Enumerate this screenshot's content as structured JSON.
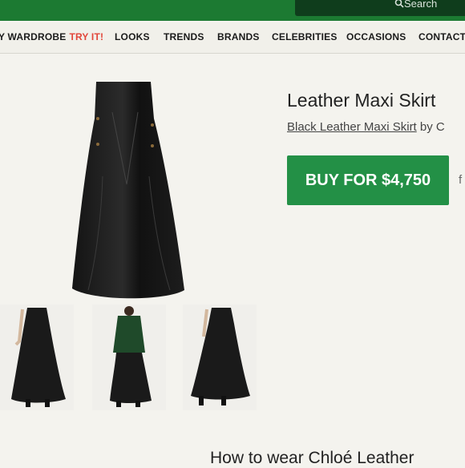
{
  "header": {
    "search_label": "Search"
  },
  "nav": {
    "wardrobe": "Y WARDROBE",
    "try_it": "TRY IT!",
    "items": [
      "LOOKS",
      "TRENDS",
      "BRANDS",
      "CELEBRITIES",
      "OCCASIONS",
      "CONTACT"
    ]
  },
  "product": {
    "title": "Leather Maxi Skirt",
    "link_text": "Black Leather Maxi Skirt",
    "by_text": "by",
    "by_initial": "C",
    "buy_label": "BUY FOR $4,750",
    "side_letter": "f"
  },
  "section": {
    "title": "How to wear Chloé Leather"
  },
  "colors": {
    "brand_green": "#1c7a32",
    "button_green": "#239046",
    "accent_red": "#e2463a"
  }
}
